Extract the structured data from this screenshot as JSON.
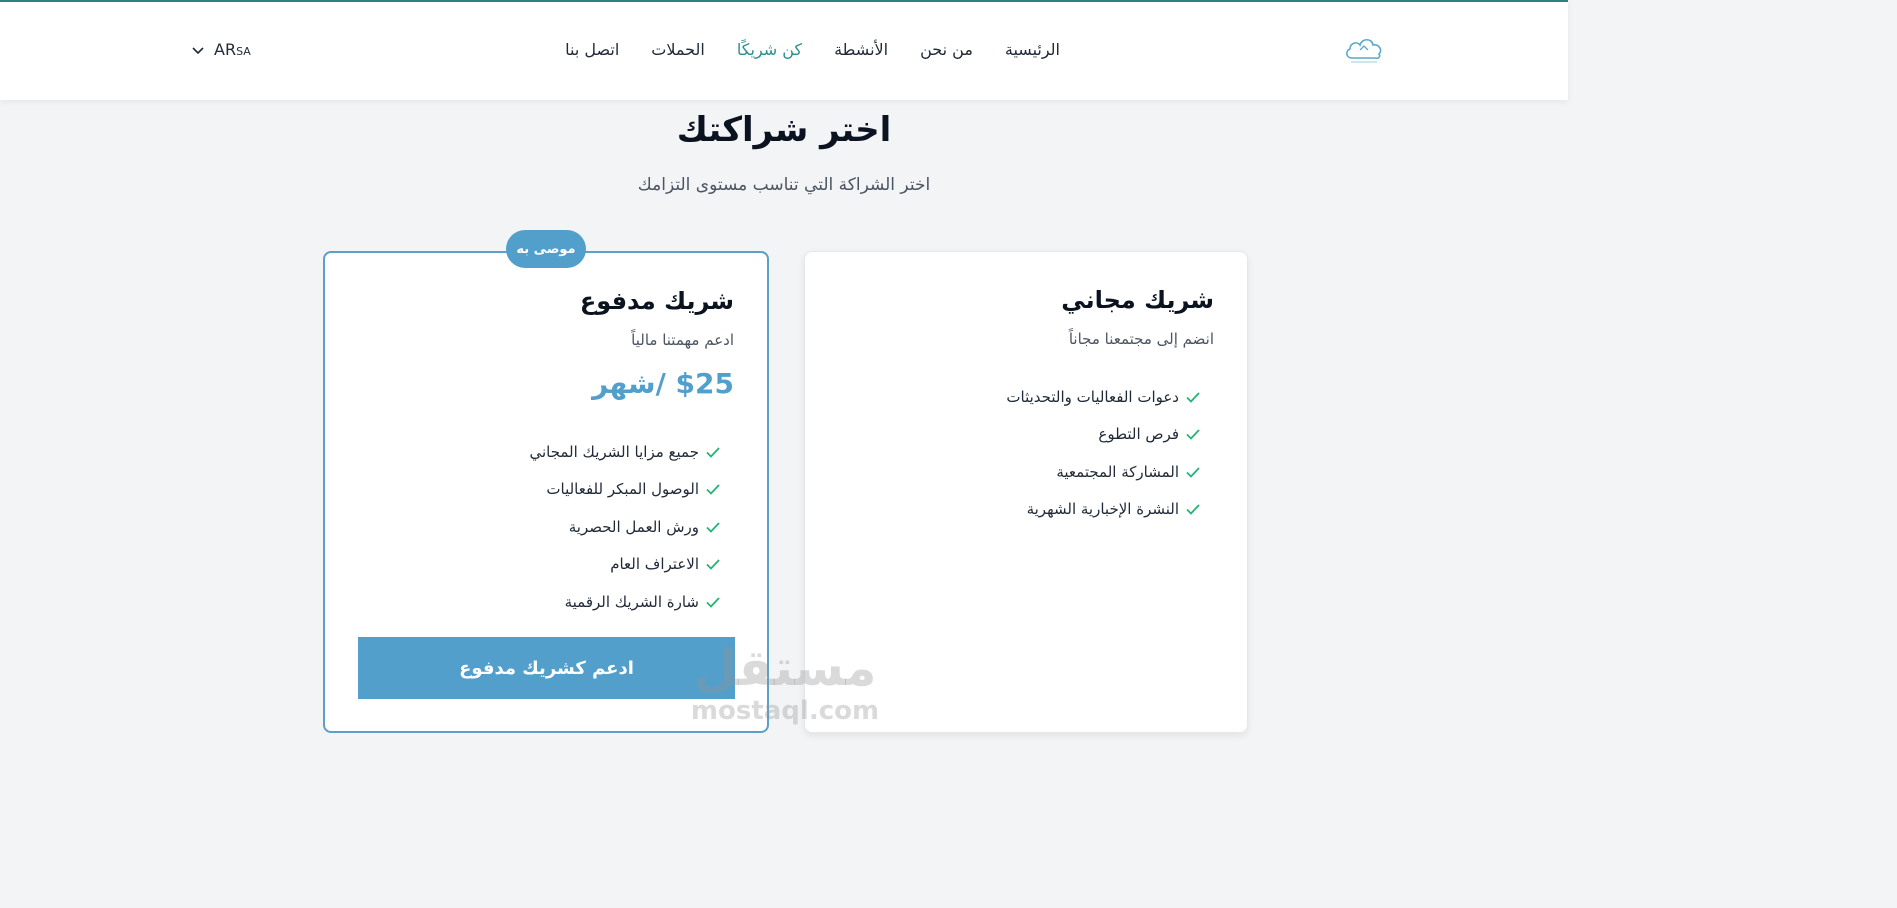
{
  "nav": {
    "items": [
      {
        "label": "الرئيسية",
        "active": false
      },
      {
        "label": "من نحن",
        "active": false
      },
      {
        "label": "الأنشطة",
        "active": false
      },
      {
        "label": "كن شريكًا",
        "active": true
      },
      {
        "label": "الحملات",
        "active": false
      },
      {
        "label": "اتصل بنا",
        "active": false
      }
    ],
    "language": {
      "code": "AR",
      "region": "SA"
    }
  },
  "page": {
    "title": "اختر شراكتك",
    "subtitle": "اختر الشراكة التي تناسب مستوى التزامك"
  },
  "plans": {
    "free": {
      "title": "شريك مجاني",
      "description": "انضم إلى مجتمعنا مجاناً",
      "features": [
        "دعوات الفعاليات والتحديثات",
        "فرص التطوع",
        "المشاركة المجتمعية",
        "النشرة الإخبارية الشهرية"
      ]
    },
    "paid": {
      "badge": "موصى به",
      "title": "شريك مدفوع",
      "description": "ادعم مهمتنا مالياً",
      "price": "$25 /شهر",
      "features": [
        "جميع مزايا الشريك المجاني",
        "الوصول المبكر للفعاليات",
        "ورش العمل الحصرية",
        "الاعتراف العام",
        "شارة الشريك الرقمية"
      ],
      "cta_label": "ادعم كشريك مدفوع"
    }
  },
  "watermark": {
    "arabic": "مستقل",
    "latin": "mostaql.com"
  },
  "colors": {
    "accent": "#529fcc",
    "nav_active": "#2a8f8d",
    "check": "#22b573"
  }
}
